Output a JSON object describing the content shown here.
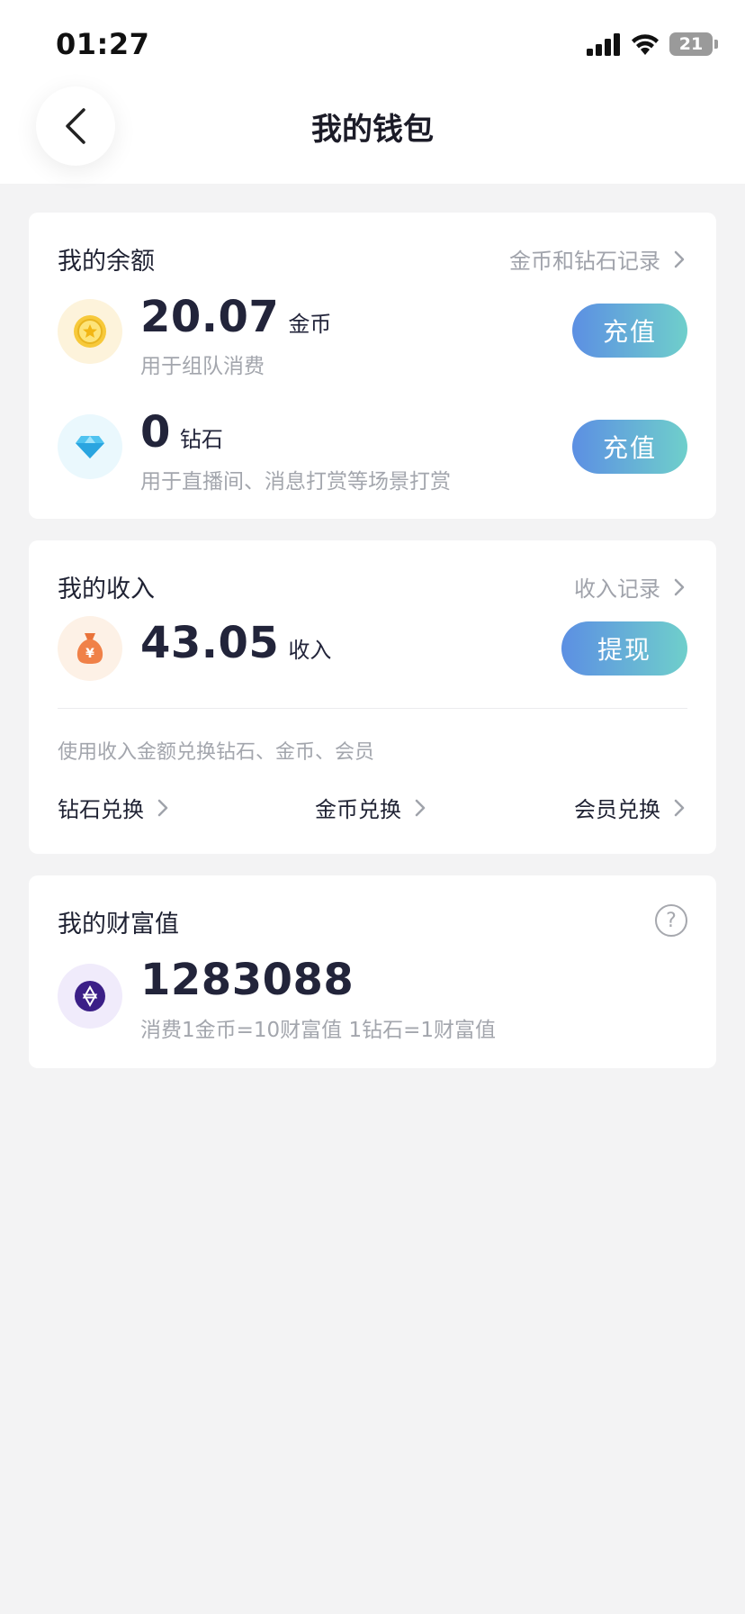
{
  "status": {
    "time": "01:27",
    "battery": "21"
  },
  "header": {
    "title": "我的钱包"
  },
  "balance": {
    "title": "我的余额",
    "link": "金币和钻石记录",
    "coins": {
      "value": "20.07",
      "unit": "金币",
      "desc": "用于组队消费",
      "button": "充值"
    },
    "diamonds": {
      "value": "0",
      "unit": "钻石",
      "desc": "用于直播间、消息打赏等场景打赏",
      "button": "充值"
    }
  },
  "income": {
    "title": "我的收入",
    "link": "收入记录",
    "value": "43.05",
    "unit": "收入",
    "button": "提现",
    "hint": "使用收入金额兑换钻石、金币、会员",
    "exchanges": [
      "钻石兑换",
      "金币兑换",
      "会员兑换"
    ]
  },
  "wealth": {
    "title": "我的财富值",
    "help": "?",
    "value": "1283088",
    "desc": "消费1金币=10财富值 1钻石=1财富值"
  },
  "colors": {
    "accent_start": "#5c8fe3",
    "accent_end": "#6fcfcb",
    "background": "#f3f3f4"
  }
}
